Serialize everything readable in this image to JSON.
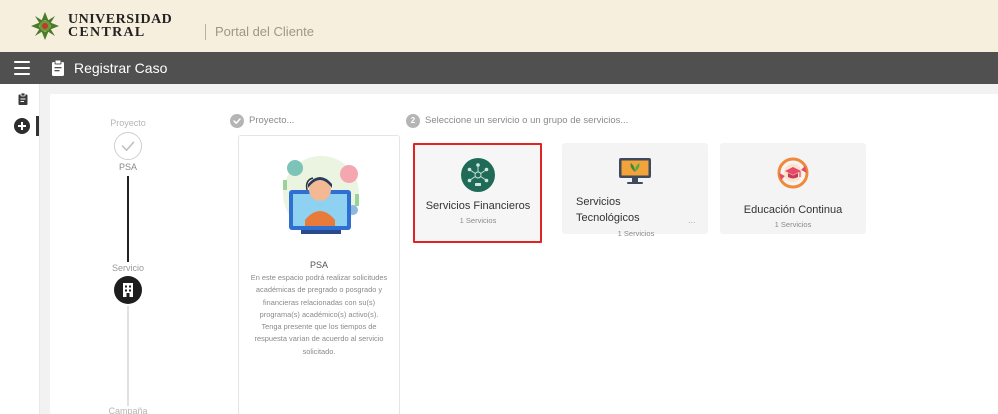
{
  "brand": {
    "name_line1": "UNIVERSIDAD",
    "name_line2": "CENTRAL",
    "portal_title": "Portal del Cliente",
    "colors": {
      "header_bg": "#f6efdd",
      "logo_green": "#4a7a2a",
      "logo_red": "#c0392b"
    }
  },
  "toolbar": {
    "menu_icon": "hamburger-icon",
    "case_icon": "clipboard-icon",
    "title": "Registrar Caso",
    "color": "#505050"
  },
  "rail": {
    "items": [
      {
        "icon": "clipboard-icon"
      },
      {
        "icon": "add-circle-icon",
        "active": true
      }
    ]
  },
  "stepper": {
    "steps": [
      {
        "label": "Proyecto",
        "value": "PSA",
        "state": "done"
      },
      {
        "label": "Servicio",
        "value": "",
        "state": "active"
      },
      {
        "label": "Campaña",
        "value": "",
        "state": "pending"
      }
    ]
  },
  "project_section": {
    "header": "Proyecto...",
    "card": {
      "illustration": "support-agent-illustration",
      "name": "PSA",
      "description": "En este espacio podrá realizar solicitudes académicas de pregrado o posgrado y financieras relacionadas con su(s) programa(s) académico(s) activo(s). Tenga presente que los tiempos de respuesta varían de acuerdo al servicio solicitado."
    }
  },
  "service_section": {
    "step_number": "2",
    "header": "Seleccione un servicio o un grupo de servicios...",
    "services": [
      {
        "title": "Servicios Financieros",
        "count": "1 Servicios",
        "icon": "finance-network-icon",
        "selected": true
      },
      {
        "title_line1": "Servicios",
        "title_line2": "Tecnológicos",
        "count": "1 Servicios",
        "icon": "monitor-plant-icon",
        "selected": false
      },
      {
        "title": "Educación Continua",
        "count": "1 Servicios",
        "icon": "graduation-cap-icon",
        "selected": false
      }
    ],
    "highlight_color": "#e02424"
  }
}
